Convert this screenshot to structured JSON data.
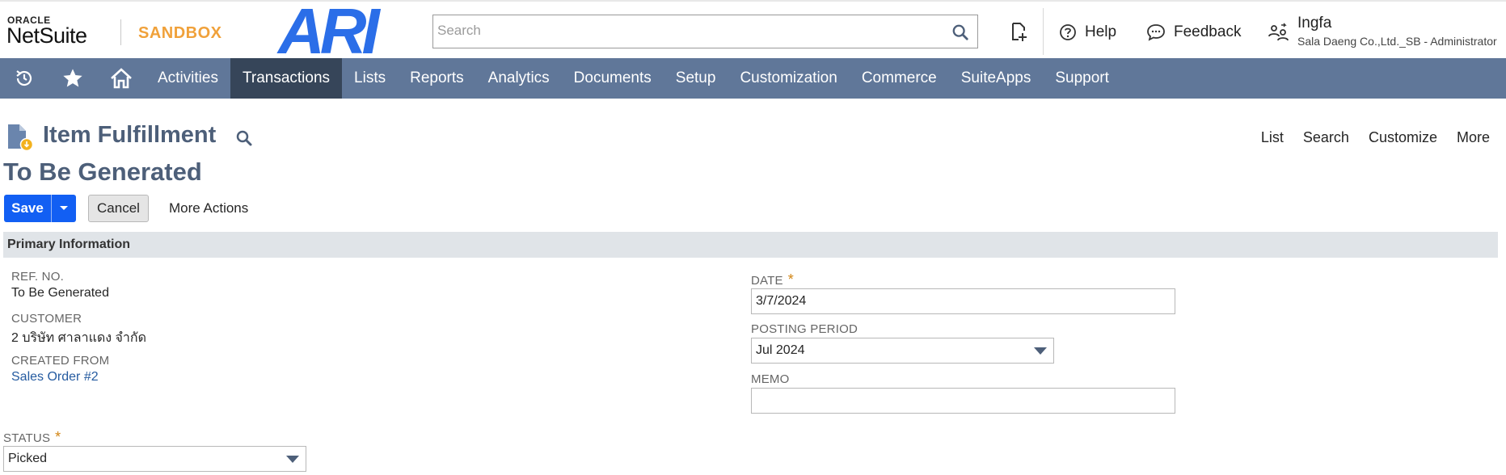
{
  "header": {
    "oracle_text": "ORACLE",
    "netsuite_text": "NetSuite",
    "environment": "SANDBOX",
    "company_logo_text": "ARI",
    "search_placeholder": "Search",
    "help_label": "Help",
    "feedback_label": "Feedback",
    "user_name": "Ingfa",
    "user_role": "Sala Daeng Co.,Ltd._SB - Administrator",
    "brand_color": "#607799",
    "sandbox_color": "#f0a13a",
    "logo_color": "#2b6ee8"
  },
  "nav": {
    "icons": [
      "recent-records-icon",
      "favorites-star-icon",
      "home-icon"
    ],
    "items": [
      {
        "label": "Activities"
      },
      {
        "label": "Transactions",
        "active": true
      },
      {
        "label": "Lists"
      },
      {
        "label": "Reports"
      },
      {
        "label": "Analytics"
      },
      {
        "label": "Documents"
      },
      {
        "label": "Setup"
      },
      {
        "label": "Customization"
      },
      {
        "label": "Commerce"
      },
      {
        "label": "SuiteApps"
      },
      {
        "label": "Support"
      }
    ]
  },
  "page": {
    "record_type": "Item Fulfillment",
    "record_name": "To Be Generated",
    "links": [
      "List",
      "Search",
      "Customize",
      "More"
    ]
  },
  "actions": {
    "save_label": "Save",
    "cancel_label": "Cancel",
    "more_actions_label": "More Actions",
    "save_color": "#125ff3"
  },
  "primary": {
    "section_title": "Primary Information",
    "ref_no_label": "REF. NO.",
    "ref_no_value": "To Be Generated",
    "customer_label": "CUSTOMER",
    "customer_value": "2 บริษัท ศาลาแดง จำกัด",
    "created_from_label": "CREATED FROM",
    "created_from_value": "Sales Order #2",
    "date_label": "DATE",
    "date_value": "3/7/2024",
    "posting_period_label": "POSTING PERIOD",
    "posting_period_value": "Jul 2024",
    "memo_label": "MEMO",
    "memo_value": "",
    "status_label": "STATUS",
    "status_value": "Picked",
    "required_mark": "*"
  }
}
